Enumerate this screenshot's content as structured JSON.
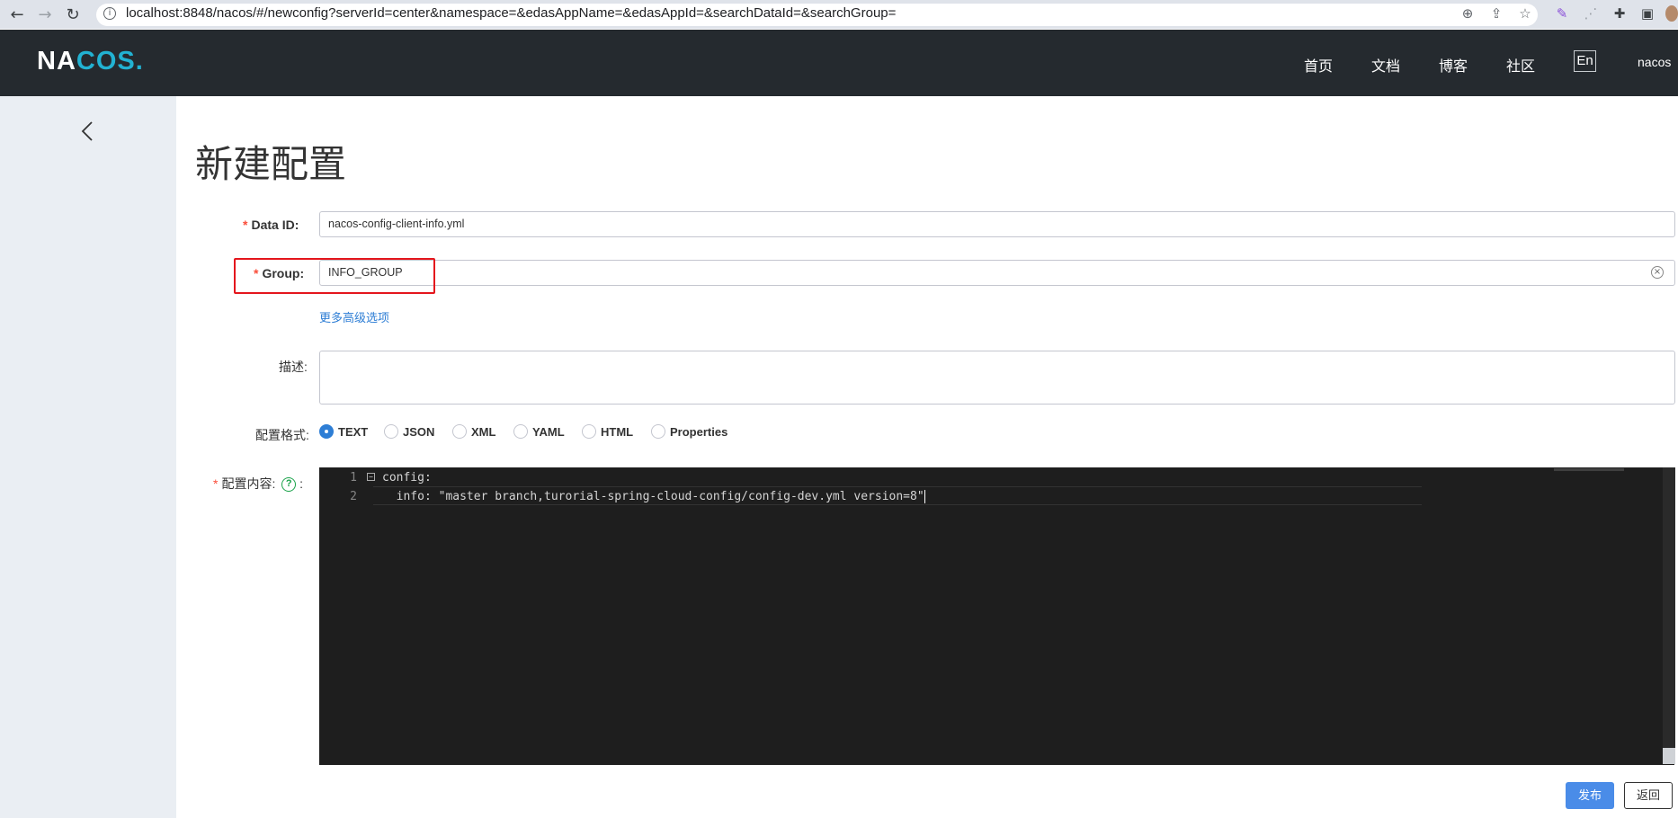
{
  "browser": {
    "url": "localhost:8848/nacos/#/newconfig?serverId=center&namespace=&edasAppName=&edasAppId=&searchDataId=&searchGroup="
  },
  "header": {
    "logo_text_1": "NA",
    "logo_text_2": "C",
    "logo_text_3": "OS",
    "logo_dot": ".",
    "nav": [
      "首页",
      "文档",
      "博客",
      "社区"
    ],
    "lang": "En",
    "user": "nacos"
  },
  "page": {
    "title": "新建配置"
  },
  "form": {
    "data_id_label": "Data ID:",
    "data_id_value": "nacos-config-client-info.yml",
    "group_label": "Group:",
    "group_value": "INFO_GROUP",
    "advanced_link": "更多高级选项",
    "description_label": "描述:",
    "format_label": "配置格式:",
    "formats": [
      "TEXT",
      "JSON",
      "XML",
      "YAML",
      "HTML",
      "Properties"
    ],
    "selected_format": "TEXT",
    "content_label": "配置内容:",
    "required_mark": "*",
    "help_icon": "?",
    "separator": ":"
  },
  "editor": {
    "lines": [
      {
        "num": "1",
        "text": "config:"
      },
      {
        "num": "2",
        "text": "  info: \"master branch,turorial-spring-cloud-config/config-dev.yml version=8\""
      }
    ]
  },
  "actions": {
    "publish": "发布",
    "back": "返回"
  }
}
